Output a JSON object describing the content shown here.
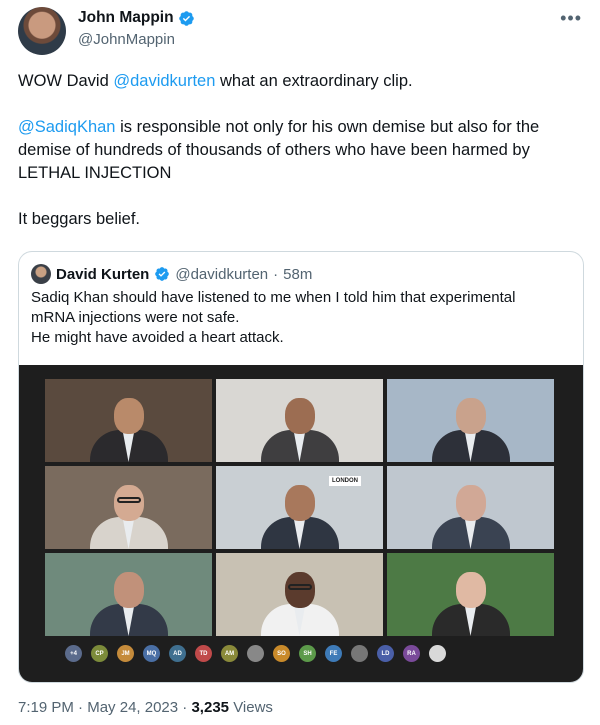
{
  "tweet": {
    "author": {
      "name": "John Mappin",
      "handle": "@JohnMappin",
      "verified_icon": "verified-badge-icon"
    },
    "more_icon": "more-options-icon",
    "lines": [
      {
        "parts": [
          {
            "t": "WOW David "
          },
          {
            "t": "@davidkurten",
            "m": true
          },
          {
            "t": " what an extraordinary clip."
          }
        ]
      },
      {
        "parts": [
          {
            "t": ""
          }
        ]
      },
      {
        "parts": [
          {
            "t": "@SadiqKhan",
            "m": true
          },
          {
            "t": " is responsible not only for his own demise but also for the"
          }
        ]
      },
      {
        "parts": [
          {
            "t": "demise of hundreds of thousands of others who have been harmed by"
          }
        ]
      },
      {
        "parts": [
          {
            "t": "LETHAL INJECTION"
          }
        ]
      },
      {
        "parts": [
          {
            "t": ""
          }
        ]
      },
      {
        "parts": [
          {
            "t": "It beggars belief."
          }
        ]
      }
    ],
    "footer": {
      "time": "7:19 PM",
      "date": "May 24, 2023",
      "views_count": "3,235",
      "views_label": "Views"
    }
  },
  "quote": {
    "author": {
      "name": "David Kurten",
      "handle": "@davidkurten",
      "age": "58m"
    },
    "text": "Sadiq Khan should have listened to me when I told him that experimental\nmRNA injections were not safe.\nHe might have avoided a heart attack.",
    "video": {
      "tiles": [
        {
          "bg": "#5a4a3e",
          "skin": "#b98a6a",
          "suit": "#2b2a2d",
          "label": ""
        },
        {
          "bg": "#d9d7d3",
          "skin": "#9c6d52",
          "suit": "#3f3e40",
          "label": ""
        },
        {
          "bg": "#a7b7c7",
          "skin": "#c9a28c",
          "suit": "#2d3039",
          "label": ""
        },
        {
          "bg": "#7a6b5e",
          "skin": "#d4aa92",
          "suit": "#d8d3cc",
          "label": ""
        },
        {
          "bg": "#c9cfd3",
          "skin": "#a8785c",
          "suit": "#2f3642",
          "label": "LONDON"
        },
        {
          "bg": "#bfc7cf",
          "skin": "#d1a896",
          "suit": "#3a4352",
          "label": ""
        },
        {
          "bg": "#6f8a7c",
          "skin": "#c1917a",
          "suit": "#333a48",
          "label": ""
        },
        {
          "bg": "#c8c1b3",
          "skin": "#5b3b2d",
          "suit": "#f1f1f1",
          "label": ""
        },
        {
          "bg": "#4d7a45",
          "skin": "#e0b9a3",
          "suit": "#2a2a2a",
          "label": ""
        }
      ],
      "participants": [
        {
          "initials": "+4",
          "color": "#5b6b8c"
        },
        {
          "initials": "CP",
          "color": "#7c8b3a"
        },
        {
          "initials": "JM",
          "color": "#c58b3b"
        },
        {
          "initials": "MQ",
          "color": "#4a6fa5"
        },
        {
          "initials": "AD",
          "color": "#3f6f8f"
        },
        {
          "initials": "TD",
          "color": "#c04a4a"
        },
        {
          "initials": "AM",
          "color": "#8a8a3a"
        },
        {
          "initials": "",
          "color": "#888888"
        },
        {
          "initials": "SO",
          "color": "#c98a2a"
        },
        {
          "initials": "SH",
          "color": "#5c9a4a"
        },
        {
          "initials": "FE",
          "color": "#3e7bb8"
        },
        {
          "initials": "",
          "color": "#777777"
        },
        {
          "initials": "LD",
          "color": "#4a5fa8"
        },
        {
          "initials": "RA",
          "color": "#7a4a9a"
        },
        {
          "initials": "",
          "color": "#d9d9d9"
        }
      ]
    }
  }
}
